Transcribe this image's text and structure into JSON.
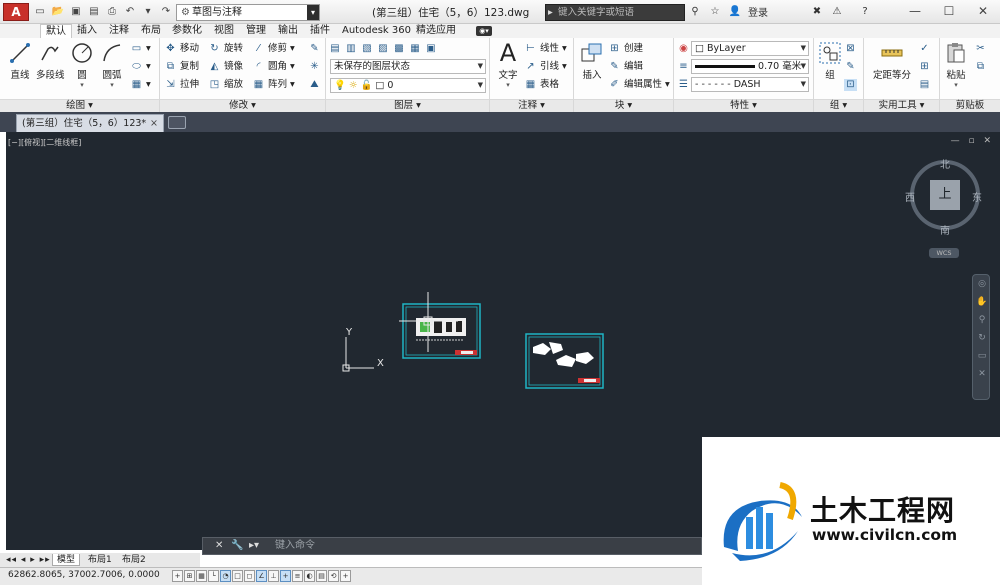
{
  "app": {
    "logo": "A"
  },
  "quick_access": {
    "workspace": "草图与注释"
  },
  "document": {
    "title": "(第三组）住宅（5，6）123.dwg"
  },
  "search": {
    "placeholder": "键入关键字或短语"
  },
  "account": {
    "signin": "登录"
  },
  "ribbon_tabs": [
    "默认",
    "插入",
    "注释",
    "布局",
    "参数化",
    "视图",
    "管理",
    "输出",
    "插件",
    "Autodesk 360",
    "精选应用"
  ],
  "panels": {
    "draw": {
      "title": "绘图 ▾",
      "line": "直线",
      "polyline": "多段线",
      "circle": "圆",
      "arc": "圆弧"
    },
    "modify": {
      "title": "修改 ▾",
      "move": "移动",
      "rotate": "旋转",
      "trim": "修剪",
      "copy": "复制",
      "mirror": "镜像",
      "fillet": "圆角",
      "stretch": "拉伸",
      "scale": "缩放",
      "array": "阵列"
    },
    "layers": {
      "title": "图层 ▾",
      "layer_state": "未保存的图层状态",
      "current_layer": "0"
    },
    "annotation": {
      "title": "注释 ▾",
      "text": "文字",
      "linear": "线性",
      "leader": "引线",
      "table": "表格"
    },
    "block": {
      "title": "块 ▾",
      "insert": "插入",
      "create": "创建",
      "edit": "编辑",
      "edit_attr": "编辑属性"
    },
    "properties": {
      "title": "特性 ▾",
      "color": "ByLayer",
      "lineweight": "0.70 毫米",
      "linetype": "DASH"
    },
    "groups": {
      "title": "组 ▾",
      "group": "组"
    },
    "utilities": {
      "title": "实用工具 ▾",
      "measure": "定距等分"
    },
    "clipboard": {
      "title": "剪贴板",
      "paste": "粘贴"
    }
  },
  "file_tab": {
    "label": "(第三组）住宅（5，6）123*"
  },
  "viewport": {
    "label": "[−][俯视][二维线框]",
    "compass": {
      "n": "北",
      "s": "南",
      "e": "东",
      "w": "西",
      "top": "上"
    },
    "wcs": "WCS",
    "ucs_x": "X",
    "ucs_y": "Y"
  },
  "command": {
    "placeholder": "键入命令"
  },
  "layout_tabs": [
    "模型",
    "布局1",
    "布局2"
  ],
  "status": {
    "coords": "62862.8065, 37002.7006, 0.0000"
  },
  "watermark": {
    "name": "土木工程网",
    "url": "www.civilcn.com"
  }
}
